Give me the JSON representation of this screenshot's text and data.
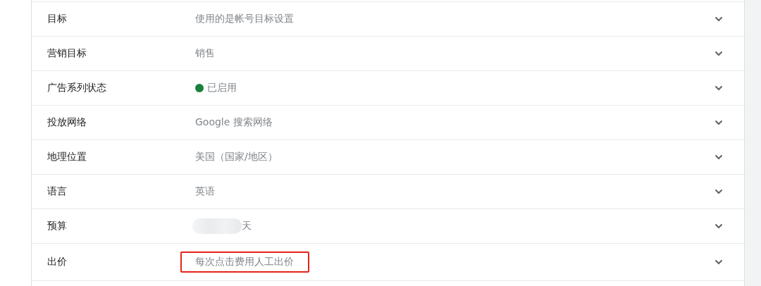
{
  "settings": [
    {
      "kind": "text",
      "label": "目标",
      "value": "使用的是帐号目标设置"
    },
    {
      "kind": "text",
      "label": "营销目标",
      "value": "销售"
    },
    {
      "kind": "status",
      "label": "广告系列状态",
      "value": "已启用",
      "color": "#188038"
    },
    {
      "kind": "text",
      "label": "投放网络",
      "value": "Google 搜索网络"
    },
    {
      "kind": "text",
      "label": "地理位置",
      "value": "美国（国家/地区）"
    },
    {
      "kind": "text",
      "label": "语言",
      "value": "英语"
    },
    {
      "kind": "redacted",
      "label": "预算",
      "value": "天"
    },
    {
      "kind": "text",
      "label": "出价",
      "value": "每次点击费用人工出价",
      "highlighted": true
    }
  ]
}
